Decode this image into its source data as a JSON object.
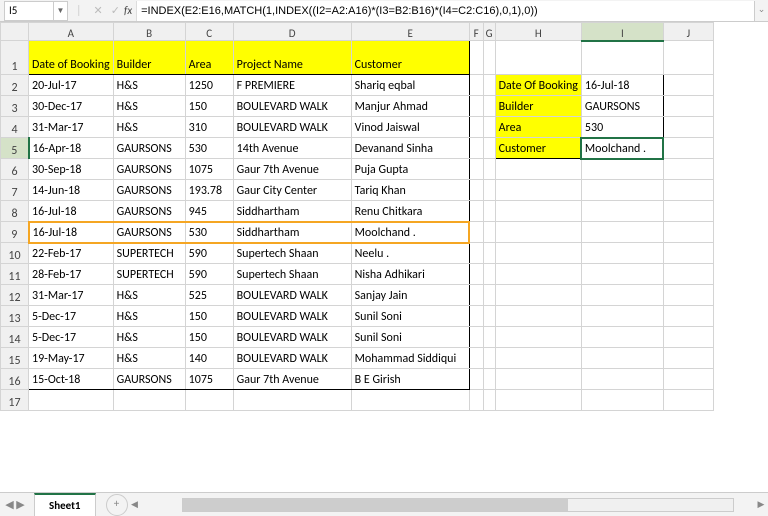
{
  "nameBox": "I5",
  "formula": "=INDEX(E2:E16,MATCH(1,INDEX((I2=A2:A16)*(I3=B2:B16)*(I4=C2:C16),0,1),0))",
  "cols": [
    "A",
    "B",
    "C",
    "D",
    "E",
    "F",
    "G",
    "H",
    "I",
    "J"
  ],
  "headers": {
    "A": "Date of Booking",
    "B": "Builder",
    "C": "Area",
    "D": "Project Name",
    "E": "Customer"
  },
  "rows": [
    {
      "A": "20-Jul-17",
      "B": "H&S",
      "C": "1250",
      "D": "F PREMIERE",
      "E": "Shariq eqbal"
    },
    {
      "A": "30-Dec-17",
      "B": "H&S",
      "C": "150",
      "D": "BOULEVARD WALK",
      "E": "Manjur Ahmad"
    },
    {
      "A": "31-Mar-17",
      "B": "H&S",
      "C": "310",
      "D": "BOULEVARD WALK",
      "E": "Vinod Jaiswal"
    },
    {
      "A": "16-Apr-18",
      "B": "GAURSONS",
      "C": "530",
      "D": "14th Avenue",
      "E": "Devanand Sinha"
    },
    {
      "A": "30-Sep-18",
      "B": "GAURSONS",
      "C": "1075",
      "D": "Gaur 7th Avenue",
      "E": "Puja Gupta"
    },
    {
      "A": "14-Jun-18",
      "B": "GAURSONS",
      "C": "193.78",
      "D": "Gaur City Center",
      "E": "Tariq Khan"
    },
    {
      "A": "16-Jul-18",
      "B": "GAURSONS",
      "C": "945",
      "D": "Siddhartham",
      "E": "Renu Chitkara"
    },
    {
      "A": "16-Jul-18",
      "B": "GAURSONS",
      "C": "530",
      "D": "Siddhartham",
      "E": "Moolchand ."
    },
    {
      "A": "22-Feb-17",
      "B": "SUPERTECH",
      "C": "590",
      "D": "Supertech Shaan",
      "E": "Neelu ."
    },
    {
      "A": "28-Feb-17",
      "B": "SUPERTECH",
      "C": "590",
      "D": "Supertech Shaan",
      "E": "Nisha Adhikari"
    },
    {
      "A": "31-Mar-17",
      "B": "H&S",
      "C": "525",
      "D": "BOULEVARD WALK",
      "E": "Sanjay Jain"
    },
    {
      "A": "5-Dec-17",
      "B": "H&S",
      "C": "150",
      "D": "BOULEVARD WALK",
      "E": "Sunil Soni"
    },
    {
      "A": "5-Dec-17",
      "B": "H&S",
      "C": "150",
      "D": "BOULEVARD WALK",
      "E": "Sunil Soni"
    },
    {
      "A": "19-May-17",
      "B": "H&S",
      "C": "140",
      "D": "BOULEVARD WALK",
      "E": "Mohammad Siddiqui"
    },
    {
      "A": "15-Oct-18",
      "B": "GAURSONS",
      "C": "1075",
      "D": "Gaur 7th Avenue",
      "E": "B E Girish"
    }
  ],
  "lookup": {
    "h2": "Date Of Booking",
    "i2": "16-Jul-18",
    "h3": "Builder",
    "i3": "GAURSONS",
    "h4": "Area",
    "i4": "530",
    "h5": "Customer",
    "i5": "Moolchand ."
  },
  "sheetName": "Sheet1"
}
